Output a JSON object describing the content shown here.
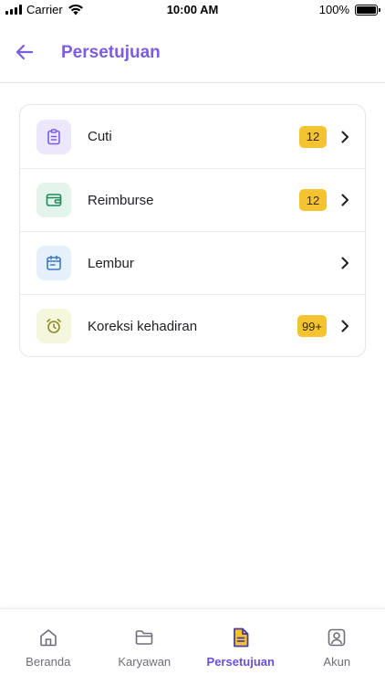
{
  "status_bar": {
    "carrier": "Carrier",
    "time": "10:00 AM",
    "battery": "100%"
  },
  "header": {
    "title": "Persetujuan",
    "back_icon": "arrow-left-icon"
  },
  "approvals": [
    {
      "label": "Cuti",
      "badge": "12",
      "icon": "clipboard-icon"
    },
    {
      "label": "Reimburse",
      "badge": "12",
      "icon": "wallet-icon"
    },
    {
      "label": "Lembur",
      "badge": "",
      "icon": "calendar-icon"
    },
    {
      "label": "Koreksi kehadiran",
      "badge": "99+",
      "icon": "alarm-clock-icon"
    }
  ],
  "bottom_nav": [
    {
      "label": "Beranda",
      "icon": "home-icon",
      "active": false
    },
    {
      "label": "Karyawan",
      "icon": "folder-icon",
      "active": false
    },
    {
      "label": "Persetujuan",
      "icon": "document-icon",
      "active": true
    },
    {
      "label": "Akun",
      "icon": "user-icon",
      "active": false
    }
  ],
  "colors": {
    "accent": "#7a5de0",
    "badge": "#f4c430",
    "active_nav": "#6a4fd6"
  }
}
